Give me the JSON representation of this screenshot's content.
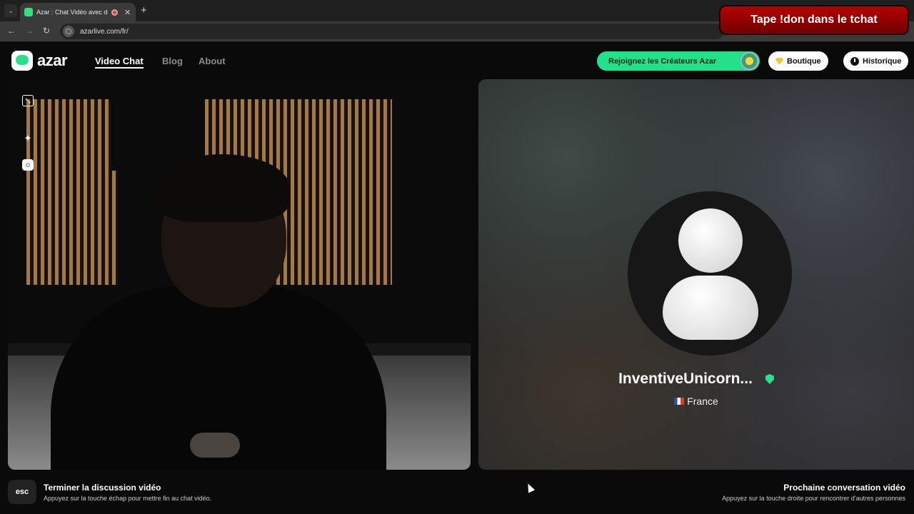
{
  "browser": {
    "tab_title": "Azar : Chat Vidéo avec de n",
    "tab_close": "✕",
    "new_tab": "+",
    "tab_menu": "⌄",
    "back": "←",
    "forward": "→",
    "reload": "↻",
    "url": "azarlive.com/fr/"
  },
  "overlay": {
    "banner_text": "Tape !don dans le tchat"
  },
  "header": {
    "logo_text": "azar",
    "nav": [
      "Video Chat",
      "Blog",
      "About"
    ],
    "creators_button": "Rejoignez les Créateurs Azar",
    "shop_button": "Boutique",
    "history_button": "Historique"
  },
  "local": {
    "icons": [
      "expand-icon",
      "sparkle-icon",
      "face-filter-icon"
    ]
  },
  "remote": {
    "name": "InventiveUnicorn...",
    "country": "France"
  },
  "footer": {
    "esc_key": "esc",
    "end_title": "Terminer la discussion vidéo",
    "end_sub": "Appuyez sur la touche échap pour mettre fin au chat vidéo.",
    "next_title": "Prochaine conversation vidéo",
    "next_sub": "Appuyez sur la touche droite pour rencontrer d'autres personnes"
  },
  "colors": {
    "accent_green": "#24e08a",
    "overlay_red": "#b80000",
    "background": "#0a0a0a"
  }
}
